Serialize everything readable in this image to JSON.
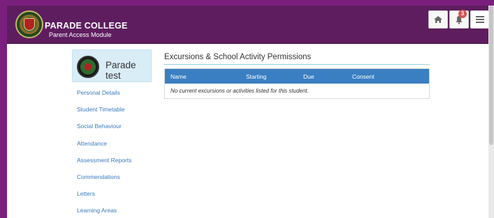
{
  "header": {
    "title": "PARADE COLLEGE",
    "subtitle": "Parent Access Module",
    "notifications_count": "3",
    "home_icon": "home-icon",
    "bell_icon": "bell-icon",
    "menu_icon": "hamburger-menu-icon"
  },
  "profile": {
    "name": "Parade test"
  },
  "sidebar": {
    "items": [
      {
        "label": "Personal Details"
      },
      {
        "label": "Student Timetable"
      },
      {
        "label": "Social Behaviour"
      },
      {
        "label": "Attendance"
      },
      {
        "label": "Assessment Reports"
      },
      {
        "label": "Commendations"
      },
      {
        "label": "Letters"
      },
      {
        "label": "Learning Areas"
      }
    ]
  },
  "main": {
    "title": "Excursions & School Activity Permissions",
    "table": {
      "columns": [
        "Name",
        "Starting",
        "Due",
        "Consent"
      ],
      "empty_message": "No current excursions or activities listed for this student."
    }
  },
  "colors": {
    "brand": "#5e1d5f",
    "outer_frame": "#7a1f7e",
    "table_header": "#3a7fc1",
    "link": "#3b7bbf",
    "profile_bg": "#d9edf7",
    "badge": "#d9534f"
  }
}
